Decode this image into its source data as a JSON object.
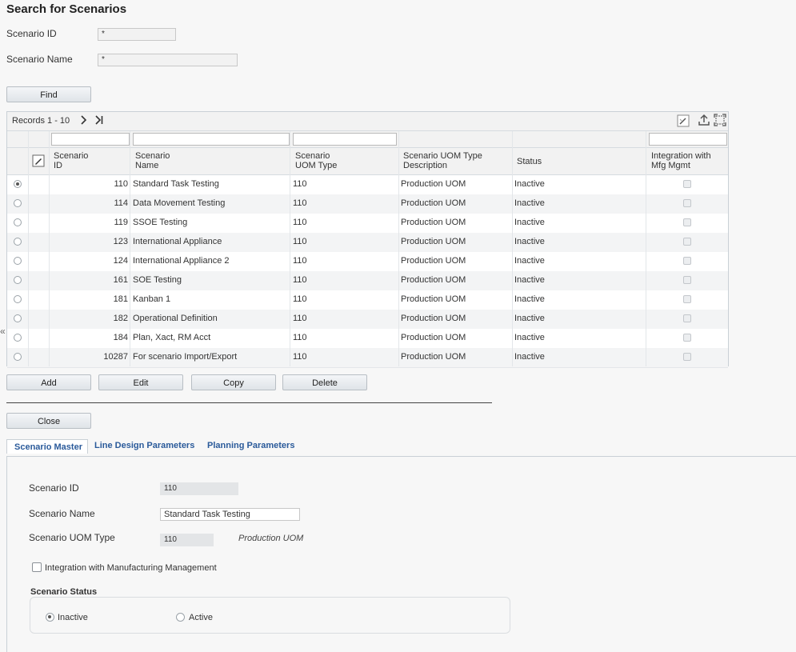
{
  "page": {
    "title": "Search for Scenarios"
  },
  "search": {
    "id_label": "Scenario ID",
    "id_value": "*",
    "name_label": "Scenario Name",
    "name_value": "*",
    "find_label": "Find"
  },
  "grid": {
    "records": "Records 1 - 10",
    "columns": {
      "id": [
        "Scenario",
        "ID"
      ],
      "name": [
        "Scenario",
        "Name"
      ],
      "uom": [
        "Scenario",
        "UOM Type"
      ],
      "desc": [
        "Scenario UOM Type",
        "Description"
      ],
      "status": "Status",
      "integ": [
        "Integration with",
        "Mfg Mgmt"
      ]
    },
    "rows": [
      {
        "id": "110",
        "name": "Standard Task Testing",
        "uom": "110",
        "desc": "Production UOM",
        "status": "Inactive",
        "selected": true
      },
      {
        "id": "114",
        "name": "Data Movement Testing",
        "uom": "110",
        "desc": "Production UOM",
        "status": "Inactive",
        "selected": false
      },
      {
        "id": "119",
        "name": "SSOE Testing",
        "uom": "110",
        "desc": "Production UOM",
        "status": "Inactive",
        "selected": false
      },
      {
        "id": "123",
        "name": "International Appliance",
        "uom": "110",
        "desc": "Production UOM",
        "status": "Inactive",
        "selected": false
      },
      {
        "id": "124",
        "name": "International Appliance 2",
        "uom": "110",
        "desc": "Production UOM",
        "status": "Inactive",
        "selected": false
      },
      {
        "id": "161",
        "name": "SOE Testing",
        "uom": "110",
        "desc": "Production UOM",
        "status": "Inactive",
        "selected": false
      },
      {
        "id": "181",
        "name": "Kanban 1",
        "uom": "110",
        "desc": "Production UOM",
        "status": "Inactive",
        "selected": false
      },
      {
        "id": "182",
        "name": "Operational Definition",
        "uom": "110",
        "desc": "Production UOM",
        "status": "Inactive",
        "selected": false
      },
      {
        "id": "184",
        "name": "Plan, Xact, RM Acct",
        "uom": "110",
        "desc": "Production UOM",
        "status": "Inactive",
        "selected": false
      },
      {
        "id": "10287",
        "name": "For scenario Import/Export",
        "uom": "110",
        "desc": "Production UOM",
        "status": "Inactive",
        "selected": false
      }
    ],
    "icons": [
      "next-page-icon",
      "last-page-icon",
      "edit-column-icon",
      "export-icon",
      "fullscreen-icon",
      "edit-row-icon"
    ]
  },
  "actions": {
    "add": "Add",
    "edit": "Edit",
    "copy": "Copy",
    "delete": "Delete",
    "close": "Close"
  },
  "tabs": [
    "Scenario Master",
    "Line Design Parameters",
    "Planning Parameters"
  ],
  "detail": {
    "id_label": "Scenario ID",
    "id_value": "110",
    "name_label": "Scenario Name",
    "name_value": "Standard Task Testing",
    "uom_label": "Scenario UOM Type",
    "uom_value": "110",
    "uom_desc": "Production UOM",
    "integration_label": "Integration with Manufacturing Management",
    "status_title": "Scenario Status",
    "status_inactive": "Inactive",
    "status_active": "Active",
    "status_selected": "Inactive"
  },
  "side_collapse": "«"
}
